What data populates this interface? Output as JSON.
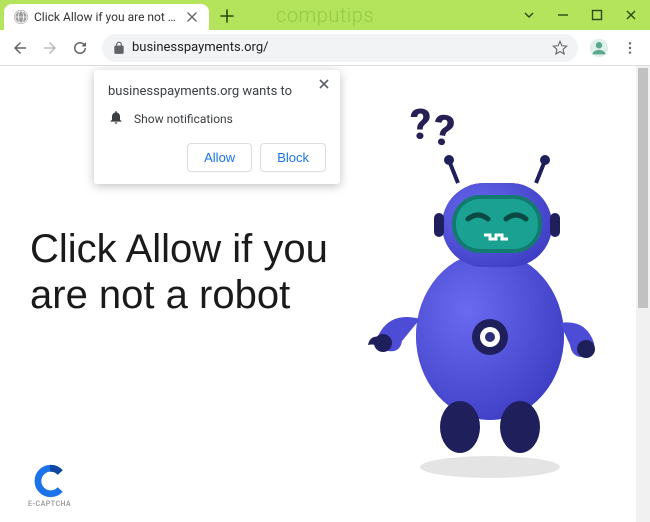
{
  "window": {
    "watermark": "computips",
    "controls": {
      "chevron": "⌄"
    }
  },
  "tab": {
    "title": "Click Allow if you are not a robot"
  },
  "toolbar": {
    "url": "businesspayments.org/"
  },
  "notification": {
    "origin": "businesspayments.org wants to",
    "permission": "Show notifications",
    "allow": "Allow",
    "block": "Block"
  },
  "page": {
    "headline": "Click Allow if you are not a robot",
    "captcha_label": "E-CAPTCHA",
    "qmarks": {
      "a": "?",
      "b": "?"
    }
  }
}
